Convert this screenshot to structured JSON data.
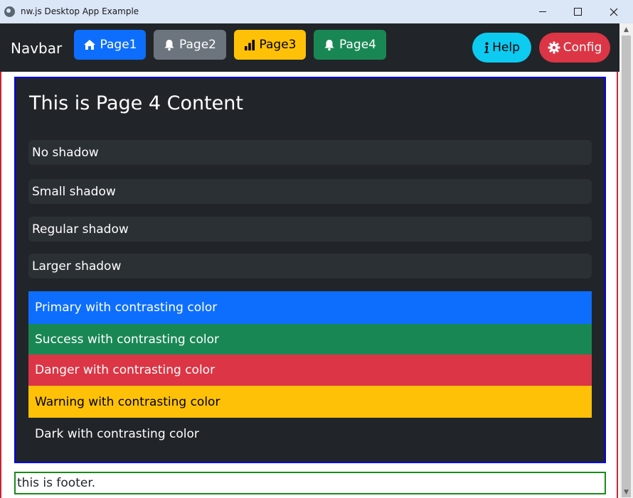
{
  "window": {
    "title": "nw.js Desktop App Example",
    "icons": {
      "app": "globe-icon",
      "minimize": "minimize-icon",
      "maximize": "maximize-icon",
      "close": "close-icon"
    }
  },
  "navbar": {
    "brand": "Navbar",
    "buttons": [
      {
        "label": "Page1",
        "icon": "home-icon",
        "color": "#0d6efd"
      },
      {
        "label": "Page2",
        "icon": "bell-icon",
        "color": "#6c757d"
      },
      {
        "label": "Page3",
        "icon": "bar-chart-icon",
        "color": "#ffc107"
      },
      {
        "label": "Page4",
        "icon": "bell-icon",
        "color": "#198754"
      }
    ],
    "help": {
      "label": "Help",
      "icon": "info-icon",
      "color": "#0dcaf0"
    },
    "config": {
      "label": "Config",
      "icon": "gear-icon",
      "color": "#dc3545"
    }
  },
  "main": {
    "title": "This is Page 4 Content",
    "shadow_boxes": [
      "No shadow",
      "Small shadow",
      "Regular shadow",
      "Larger shadow"
    ],
    "color_rows": [
      {
        "label": "Primary with contrasting color",
        "color": "#0d6efd"
      },
      {
        "label": "Success with contrasting color",
        "color": "#198754"
      },
      {
        "label": "Danger with contrasting color",
        "color": "#dc3545"
      },
      {
        "label": "Warning with contrasting color",
        "color": "#ffc107"
      },
      {
        "label": "Dark with contrasting color",
        "color": "#212529"
      }
    ]
  },
  "footer": {
    "text": "this is footer."
  }
}
